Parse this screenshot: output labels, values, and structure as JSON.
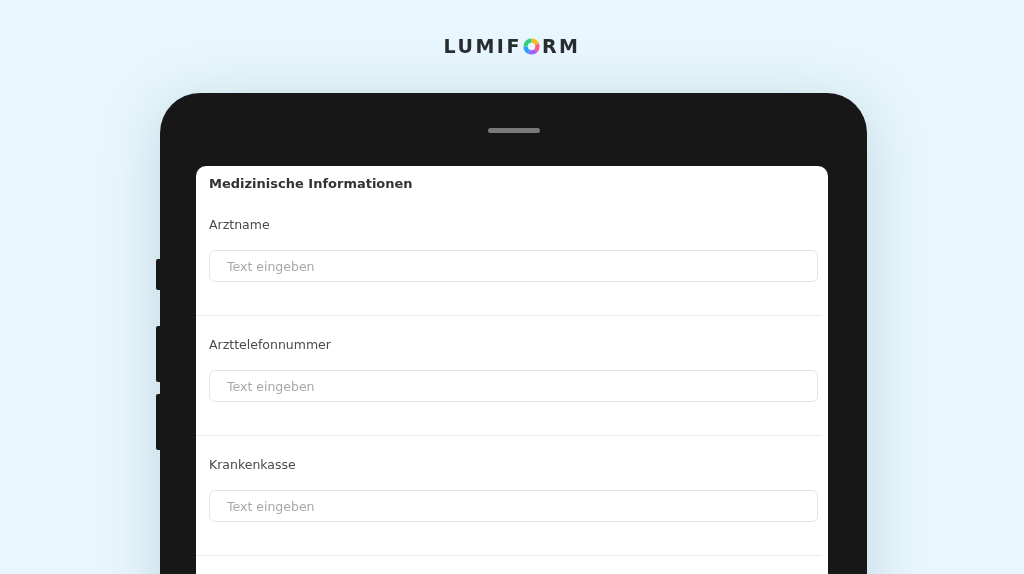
{
  "logo": {
    "before": "LUMIF",
    "after": "RM"
  },
  "form": {
    "title": "Medizinische Informationen",
    "fields": [
      {
        "label": "Arztname",
        "placeholder": "Text eingeben"
      },
      {
        "label": "Arzttelefonnummer",
        "placeholder": "Text eingeben"
      },
      {
        "label": "Krankenkasse",
        "placeholder": "Text eingeben"
      }
    ]
  }
}
